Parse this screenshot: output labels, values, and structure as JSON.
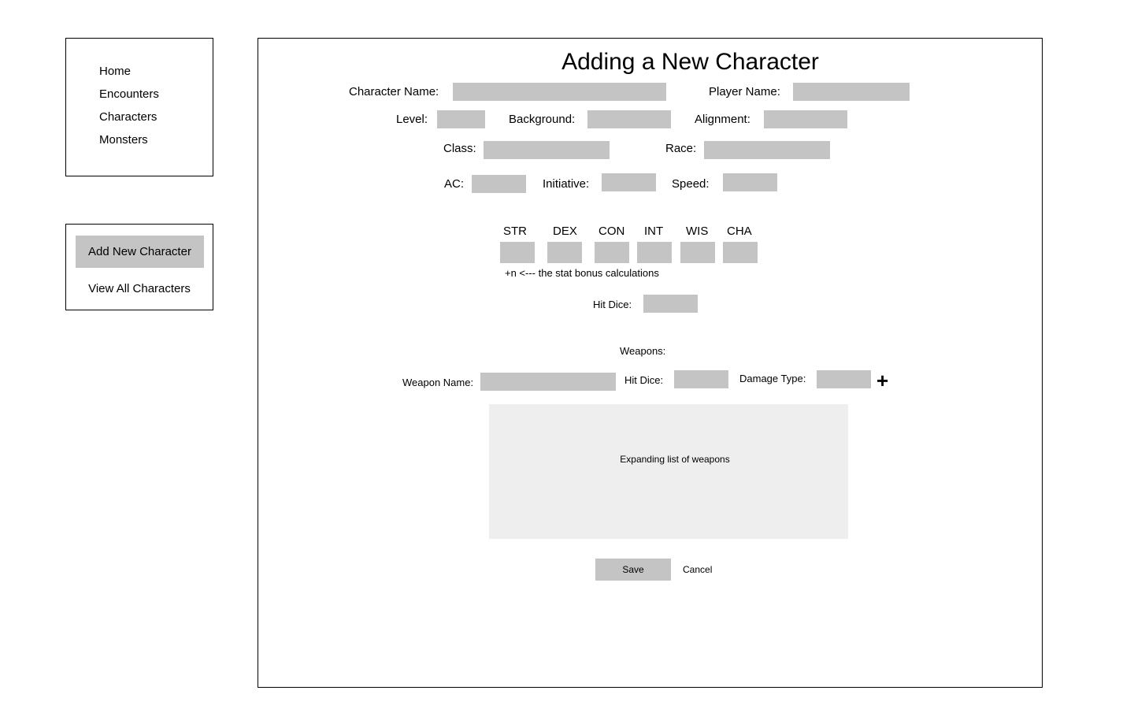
{
  "nav": {
    "items": [
      "Home",
      "Encounters",
      "Characters",
      "Monsters"
    ]
  },
  "subnav": {
    "add_label": "Add New Character",
    "view_label": "View All Characters"
  },
  "form": {
    "title": "Adding a New Character",
    "character_name_label": "Character Name:",
    "player_name_label": "Player Name:",
    "level_label": "Level:",
    "background_label": "Background:",
    "alignment_label": "Alignment:",
    "class_label": "Class:",
    "race_label": "Race:",
    "ac_label": "AC:",
    "initiative_label": "Initiative:",
    "speed_label": "Speed:",
    "stats": [
      "STR",
      "DEX",
      "CON",
      "INT",
      "WIS",
      "CHA"
    ],
    "stat_bonus_note": "+n <--- the stat bonus calculations",
    "hit_dice_label": "Hit Dice:",
    "weapons_heading": "Weapons:",
    "weapon_name_label": "Weapon Name:",
    "weapon_hit_dice_label": "Hit Dice:",
    "damage_type_label": "Damage Type:",
    "add_weapon_icon": "+",
    "weapon_list_placeholder": "Expanding list of weapons",
    "save_label": "Save",
    "cancel_label": "Cancel"
  },
  "colors": {
    "input": "#c4c4c4",
    "list_bg": "#eeeeee"
  }
}
